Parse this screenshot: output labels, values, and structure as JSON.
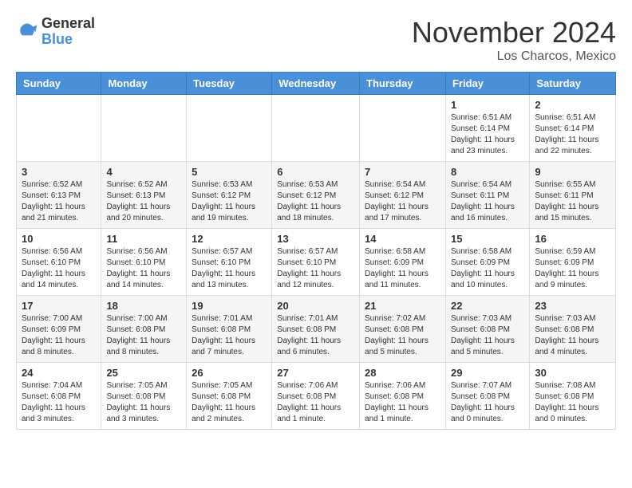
{
  "header": {
    "logo": {
      "general": "General",
      "blue": "Blue"
    },
    "month_title": "November 2024",
    "location": "Los Charcos, Mexico"
  },
  "calendar": {
    "days_of_week": [
      "Sunday",
      "Monday",
      "Tuesday",
      "Wednesday",
      "Thursday",
      "Friday",
      "Saturday"
    ],
    "weeks": [
      [
        {
          "day": "",
          "info": ""
        },
        {
          "day": "",
          "info": ""
        },
        {
          "day": "",
          "info": ""
        },
        {
          "day": "",
          "info": ""
        },
        {
          "day": "",
          "info": ""
        },
        {
          "day": "1",
          "info": "Sunrise: 6:51 AM\nSunset: 6:14 PM\nDaylight: 11 hours and 23 minutes."
        },
        {
          "day": "2",
          "info": "Sunrise: 6:51 AM\nSunset: 6:14 PM\nDaylight: 11 hours and 22 minutes."
        }
      ],
      [
        {
          "day": "3",
          "info": "Sunrise: 6:52 AM\nSunset: 6:13 PM\nDaylight: 11 hours and 21 minutes."
        },
        {
          "day": "4",
          "info": "Sunrise: 6:52 AM\nSunset: 6:13 PM\nDaylight: 11 hours and 20 minutes."
        },
        {
          "day": "5",
          "info": "Sunrise: 6:53 AM\nSunset: 6:12 PM\nDaylight: 11 hours and 19 minutes."
        },
        {
          "day": "6",
          "info": "Sunrise: 6:53 AM\nSunset: 6:12 PM\nDaylight: 11 hours and 18 minutes."
        },
        {
          "day": "7",
          "info": "Sunrise: 6:54 AM\nSunset: 6:12 PM\nDaylight: 11 hours and 17 minutes."
        },
        {
          "day": "8",
          "info": "Sunrise: 6:54 AM\nSunset: 6:11 PM\nDaylight: 11 hours and 16 minutes."
        },
        {
          "day": "9",
          "info": "Sunrise: 6:55 AM\nSunset: 6:11 PM\nDaylight: 11 hours and 15 minutes."
        }
      ],
      [
        {
          "day": "10",
          "info": "Sunrise: 6:56 AM\nSunset: 6:10 PM\nDaylight: 11 hours and 14 minutes."
        },
        {
          "day": "11",
          "info": "Sunrise: 6:56 AM\nSunset: 6:10 PM\nDaylight: 11 hours and 14 minutes."
        },
        {
          "day": "12",
          "info": "Sunrise: 6:57 AM\nSunset: 6:10 PM\nDaylight: 11 hours and 13 minutes."
        },
        {
          "day": "13",
          "info": "Sunrise: 6:57 AM\nSunset: 6:10 PM\nDaylight: 11 hours and 12 minutes."
        },
        {
          "day": "14",
          "info": "Sunrise: 6:58 AM\nSunset: 6:09 PM\nDaylight: 11 hours and 11 minutes."
        },
        {
          "day": "15",
          "info": "Sunrise: 6:58 AM\nSunset: 6:09 PM\nDaylight: 11 hours and 10 minutes."
        },
        {
          "day": "16",
          "info": "Sunrise: 6:59 AM\nSunset: 6:09 PM\nDaylight: 11 hours and 9 minutes."
        }
      ],
      [
        {
          "day": "17",
          "info": "Sunrise: 7:00 AM\nSunset: 6:09 PM\nDaylight: 11 hours and 8 minutes."
        },
        {
          "day": "18",
          "info": "Sunrise: 7:00 AM\nSunset: 6:08 PM\nDaylight: 11 hours and 8 minutes."
        },
        {
          "day": "19",
          "info": "Sunrise: 7:01 AM\nSunset: 6:08 PM\nDaylight: 11 hours and 7 minutes."
        },
        {
          "day": "20",
          "info": "Sunrise: 7:01 AM\nSunset: 6:08 PM\nDaylight: 11 hours and 6 minutes."
        },
        {
          "day": "21",
          "info": "Sunrise: 7:02 AM\nSunset: 6:08 PM\nDaylight: 11 hours and 5 minutes."
        },
        {
          "day": "22",
          "info": "Sunrise: 7:03 AM\nSunset: 6:08 PM\nDaylight: 11 hours and 5 minutes."
        },
        {
          "day": "23",
          "info": "Sunrise: 7:03 AM\nSunset: 6:08 PM\nDaylight: 11 hours and 4 minutes."
        }
      ],
      [
        {
          "day": "24",
          "info": "Sunrise: 7:04 AM\nSunset: 6:08 PM\nDaylight: 11 hours and 3 minutes."
        },
        {
          "day": "25",
          "info": "Sunrise: 7:05 AM\nSunset: 6:08 PM\nDaylight: 11 hours and 3 minutes."
        },
        {
          "day": "26",
          "info": "Sunrise: 7:05 AM\nSunset: 6:08 PM\nDaylight: 11 hours and 2 minutes."
        },
        {
          "day": "27",
          "info": "Sunrise: 7:06 AM\nSunset: 6:08 PM\nDaylight: 11 hours and 1 minute."
        },
        {
          "day": "28",
          "info": "Sunrise: 7:06 AM\nSunset: 6:08 PM\nDaylight: 11 hours and 1 minute."
        },
        {
          "day": "29",
          "info": "Sunrise: 7:07 AM\nSunset: 6:08 PM\nDaylight: 11 hours and 0 minutes."
        },
        {
          "day": "30",
          "info": "Sunrise: 7:08 AM\nSunset: 6:08 PM\nDaylight: 11 hours and 0 minutes."
        }
      ]
    ]
  }
}
